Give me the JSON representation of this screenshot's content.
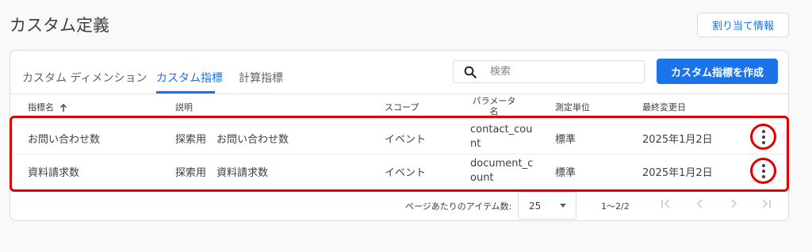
{
  "header": {
    "title": "カスタム定義",
    "attribution_button": "割り当て情報"
  },
  "tabs": [
    {
      "label": "カスタム ディメンション",
      "active": false
    },
    {
      "label": "カスタム指標",
      "active": true
    },
    {
      "label": "計算指標",
      "active": false
    }
  ],
  "search": {
    "placeholder": "検索",
    "icon": "search-icon"
  },
  "create_button": "カスタム指標を作成",
  "table": {
    "columns": {
      "name": "指標名",
      "description": "説明",
      "scope": "スコープ",
      "parameter": "パラメータ名",
      "unit": "測定単位",
      "modified": "最終変更日"
    },
    "sort_icon": "arrow-up-icon",
    "rows": [
      {
        "name": "お問い合わせ数",
        "description": "探索用　お問い合わせ数",
        "scope": "イベント",
        "parameter": "contact_count",
        "unit": "標準",
        "modified": "2025年1月2日"
      },
      {
        "name": "資料請求数",
        "description": "探索用　資料請求数",
        "scope": "イベント",
        "parameter": "document_count",
        "unit": "標準",
        "modified": "2025年1月2日"
      }
    ]
  },
  "pagination": {
    "items_per_page_label": "ページあたりのアイテム数:",
    "items_per_page_value": "25",
    "range": "1～2/2"
  },
  "colors": {
    "accent": "#1a73e8",
    "highlight": "#e00000"
  }
}
